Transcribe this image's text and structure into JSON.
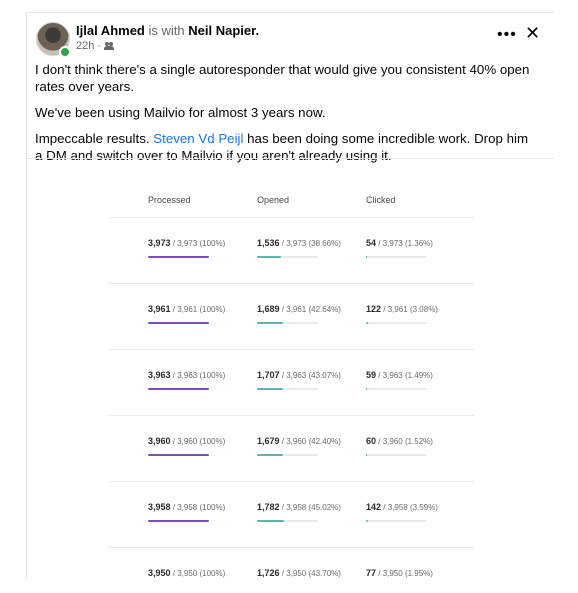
{
  "post": {
    "author": "Ijlal Ahmed",
    "with_text": "is with",
    "tagged": "Neil Napier.",
    "time": "22h",
    "sep": "·",
    "more_label": "•••",
    "close_label": "✕",
    "p1": "I don't think there's a single autoresponder that would give you consistent 40% open rates over years.",
    "p2": "We've been using Mailvio for almost 3 years now.",
    "p3_pre": "Impeccable results.",
    "p3_tag": "Steven Vd Peijl",
    "p3_post": "has been doing some incredible work. Drop him a DM and switch over to Mailvio if you aren't already using it."
  },
  "stats": {
    "headers": [
      "Processed",
      "Opened",
      "Clicked"
    ],
    "rows": [
      {
        "processed": "3,973",
        "processed_rest": "/ 3,973 (100%)",
        "processed_frac": 1.0,
        "opened": "1,536",
        "opened_rest": "/ 3,973 (38.66%)",
        "opened_frac": 0.3866,
        "clicked": "54",
        "clicked_rest": "/ 3,973 (1.36%)",
        "clicked_frac": 0.0136
      },
      {
        "processed": "3,961",
        "processed_rest": "/ 3,961 (100%)",
        "processed_frac": 1.0,
        "opened": "1,689",
        "opened_rest": "/ 3,961 (42.64%)",
        "opened_frac": 0.4264,
        "clicked": "122",
        "clicked_rest": "/ 3,961 (3.08%)",
        "clicked_frac": 0.0308
      },
      {
        "processed": "3,963",
        "processed_rest": "/ 3,963 (100%)",
        "processed_frac": 1.0,
        "opened": "1,707",
        "opened_rest": "/ 3,963 (43.07%)",
        "opened_frac": 0.4307,
        "clicked": "59",
        "clicked_rest": "/ 3,963 (1.49%)",
        "clicked_frac": 0.0149
      },
      {
        "processed": "3,960",
        "processed_rest": "/ 3,960 (100%)",
        "processed_frac": 1.0,
        "opened": "1,679",
        "opened_rest": "/ 3,960 (42.40%)",
        "opened_frac": 0.424,
        "clicked": "60",
        "clicked_rest": "/ 3,960 (1.52%)",
        "clicked_frac": 0.0152
      },
      {
        "processed": "3,958",
        "processed_rest": "/ 3,958 (100%)",
        "processed_frac": 1.0,
        "opened": "1,782",
        "opened_rest": "/ 3,958 (45.02%)",
        "opened_frac": 0.4502,
        "clicked": "142",
        "clicked_rest": "/ 3,958 (3.59%)",
        "clicked_frac": 0.0359
      },
      {
        "processed": "3,950",
        "processed_rest": "/ 3,950 (100%)",
        "processed_frac": 1.0,
        "opened": "1,726",
        "opened_rest": "/ 3,950 (43.70%)",
        "opened_frac": 0.437,
        "clicked": "77",
        "clicked_rest": "/ 3,950 (1.95%)",
        "clicked_frac": 0.0195
      }
    ]
  }
}
